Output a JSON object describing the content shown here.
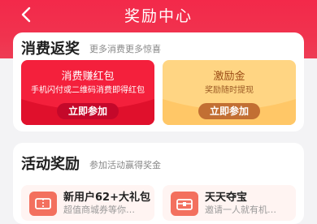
{
  "header": {
    "title": "奖励中心",
    "back_icon": "chevron-left-icon"
  },
  "consume": {
    "title": "消费返奖",
    "subtitle": "更多消费更多惊喜",
    "coupons": [
      {
        "title": "消费赚红包",
        "desc": "手机闪付或二维码消费即得红包",
        "button": "立即参加",
        "bg": "#f4203c"
      },
      {
        "title": "激励金",
        "desc": "奖励随时提现",
        "button": "立即参加",
        "bg": "#ffd583"
      }
    ]
  },
  "activity": {
    "title": "活动奖励",
    "subtitle": "参加活动赢得奖金",
    "items": [
      {
        "title": "新用户62+大礼包",
        "desc": "超值商城券等你…",
        "icon": "gift-coupon-icon"
      },
      {
        "title": "天天夺宝",
        "desc": "邀请一人就有机…",
        "icon": "treasure-box-icon"
      }
    ]
  },
  "colors": {
    "accent": "#f3294a",
    "background": "#f3f3f5"
  }
}
